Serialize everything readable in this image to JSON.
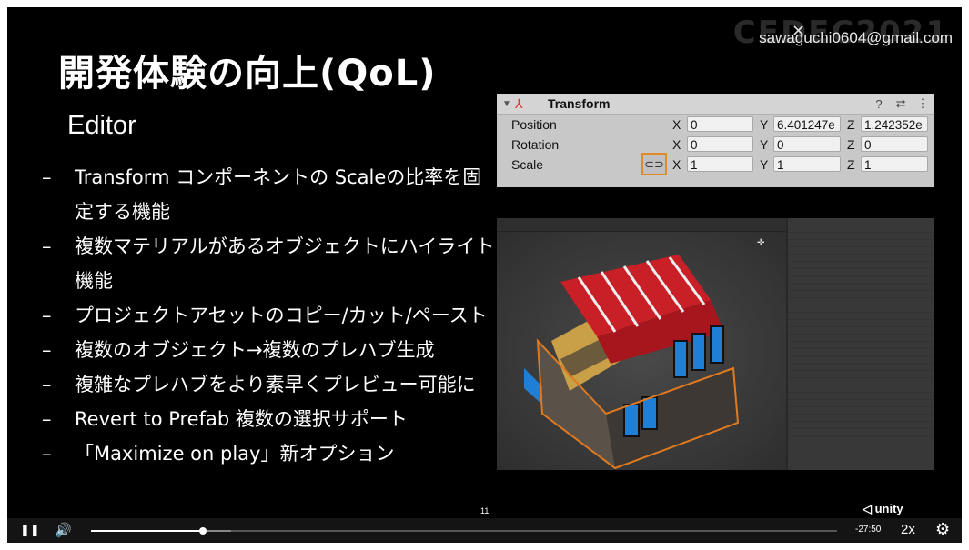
{
  "overlay": {
    "watermark": "CEDEC2021",
    "email": "sawaguchi0604@gmail.com",
    "close_mark": "✕"
  },
  "slide": {
    "title": "開発体験の向上(QoL)",
    "subtitle": "Editor",
    "bullet_dash": "–",
    "bullets": [
      "Transform コンポーネントの Scaleの比率を固定する機能",
      "複数マテリアルがあるオブジェクトにハイライト機能",
      "プロジェクトアセットのコピー/カット/ペースト",
      "複数のオブジェクト→複数のプレハブ生成",
      "複雑なプレハブをより素早くプレビュー可能に",
      "Revert to Prefab 複数の選択サポート",
      "「Maximize on play」新オプション"
    ],
    "page_number": "11",
    "logo_text": "unity"
  },
  "transform_panel": {
    "title": "Transform",
    "rows": [
      {
        "label": "Position",
        "x": "0",
        "y": "6.401247e",
        "z": "1.242352e"
      },
      {
        "label": "Rotation",
        "x": "0",
        "y": "0",
        "z": "0"
      },
      {
        "label": "Scale",
        "x": "1",
        "y": "1",
        "z": "1"
      }
    ],
    "axis_x": "X",
    "axis_y": "Y",
    "axis_z": "Z",
    "icons": [
      "help-icon",
      "preset-icon",
      "more-icon"
    ],
    "highlight_color": "#e28a25"
  },
  "player": {
    "time_remaining": "-27:50",
    "speed": "2x",
    "progress": 0.15,
    "buffered": 0.188
  }
}
